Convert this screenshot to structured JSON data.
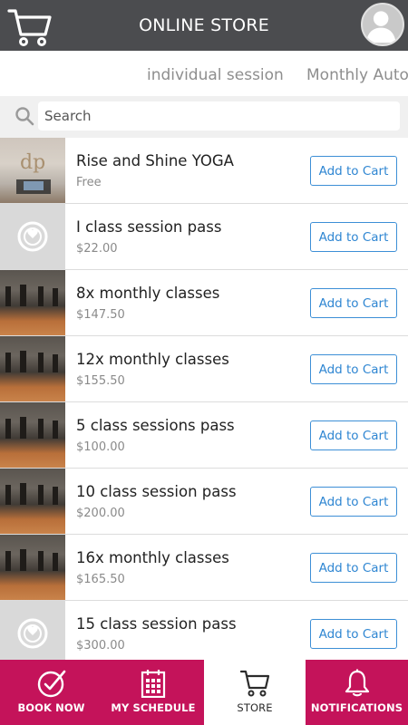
{
  "header": {
    "title": "ONLINE STORE",
    "cart_icon": "cart-icon",
    "avatar_icon": "user-avatar"
  },
  "tabs": [
    {
      "label": "individual session"
    },
    {
      "label": "Monthly Autop"
    }
  ],
  "search": {
    "placeholder": "Search",
    "value": ""
  },
  "products": [
    {
      "name": "Rise and Shine YOGA",
      "price": "Free",
      "button": "Add to Cart",
      "thumb": "yoga"
    },
    {
      "name": "I class session pass",
      "price": "$22.00",
      "button": "Add to Cart",
      "thumb": "logo"
    },
    {
      "name": "8x monthly classes",
      "price": "$147.50",
      "button": "Add to Cart",
      "thumb": "studio"
    },
    {
      "name": "12x monthly classes",
      "price": "$155.50",
      "button": "Add to Cart",
      "thumb": "studio"
    },
    {
      "name": "5 class sessions pass",
      "price": "$100.00",
      "button": "Add to Cart",
      "thumb": "studio"
    },
    {
      "name": "10 class session pass",
      "price": "$200.00",
      "button": "Add to Cart",
      "thumb": "studio"
    },
    {
      "name": "16x monthly classes",
      "price": "$165.50",
      "button": "Add to Cart",
      "thumb": "studio"
    },
    {
      "name": "15 class session pass",
      "price": "$300.00",
      "button": "Add to Cart",
      "thumb": "logo"
    }
  ],
  "nav": [
    {
      "label": "BOOK NOW",
      "icon": "check-circle-icon",
      "active": false
    },
    {
      "label": "MY SCHEDULE",
      "icon": "calendar-icon",
      "active": false
    },
    {
      "label": "STORE",
      "icon": "cart-icon",
      "active": true
    },
    {
      "label": "NOTIFICATIONS",
      "icon": "bell-icon",
      "active": false
    }
  ],
  "colors": {
    "header": "#4b4c4f",
    "accent": "#c4135a",
    "button": "#2f86d2"
  }
}
